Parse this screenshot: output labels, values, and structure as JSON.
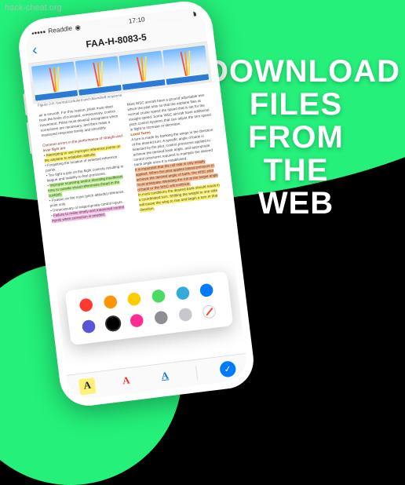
{
  "watermark": "hack-cheat.org",
  "headline": {
    "l1": "DOWNLOAD",
    "l2": "FILES",
    "l3": "FROM",
    "l4": "THE",
    "l5": "WEB"
  },
  "statusbar": {
    "carrier": "Readdle",
    "time": "17:10"
  },
  "header": {
    "title": "FAA-H-8083-5"
  },
  "figure": {
    "caption": "Figure 3-8. Normal turbulent and downdraft response."
  },
  "text": {
    "p1": "air is smooth. For this reason, pilots must steer from the limits of constant, unnecessary, control movement. Pilots must develop recognition when corrections are necessary, and then make a measured response timely and smoothly.",
    "h1": "Common errors in the performance of straight-and-level flight are:",
    "b1": "Attempting to use improper reference points on the airplane to establish attitude.",
    "b2": "Forgetting the location of selected reference points.",
    "b3": "Too tight a grip on the flight controls resulting in fatigue and inability to feel pressures.",
    "b4": "Improper scanning and/or devoting insufficient time to outside visual references (head in the cockpit).",
    "b5": "Fixation on the nose (pitch attitude) reference point only.",
    "b6": "Unnecessary or inappropriate control inputs.",
    "b7": "Failure to make timely and measured control inputs when correction is needed.",
    "c2a": "Most WSC aircraft have a ground adjustable trim which the pilot sets so that the airplane flies at normal cruise speed the speed that is set for the straight speed. Some WSC aircraft have additional pitch control systems that can adjust the trim speed in flight to increase or decrease.",
    "c2h": "Level Turns",
    "c2b": "A turn is made by banking the wings in the direction of the desired turn. A specific angle of bank is selected by the pilot, control pressures applied to achieve the desired bank angle, and appropriate control pressures required to maintain the desired bank angle once it is established.",
    "c2c": "It is important that the roll rate is only initially applied. When the pilot applies lateral pressure to achieve the desired angle of bank, the WSC pilot must anticipate releasing the roll at the target angle of bank or the WSC will continue.",
    "c2d": "In most conditions the desired bank should result in a coordinated turn. Shifting the weight to one side will cause the wing to rise and begin a turn in that direction."
  },
  "colors": {
    "r1": "#ff3b30",
    "r2": "#ff9500",
    "r3": "#ffcc00",
    "r4": "#4cd964",
    "r5": "#34aadc",
    "r6": "#007aff",
    "r7": "#5856d6",
    "r8": "#000000",
    "r9": "#ff2d92",
    "r10": "#8e8e93",
    "r11": "#c7c7cc"
  },
  "toolbar": {
    "highlight": "A",
    "color": "A",
    "underline": "A"
  }
}
